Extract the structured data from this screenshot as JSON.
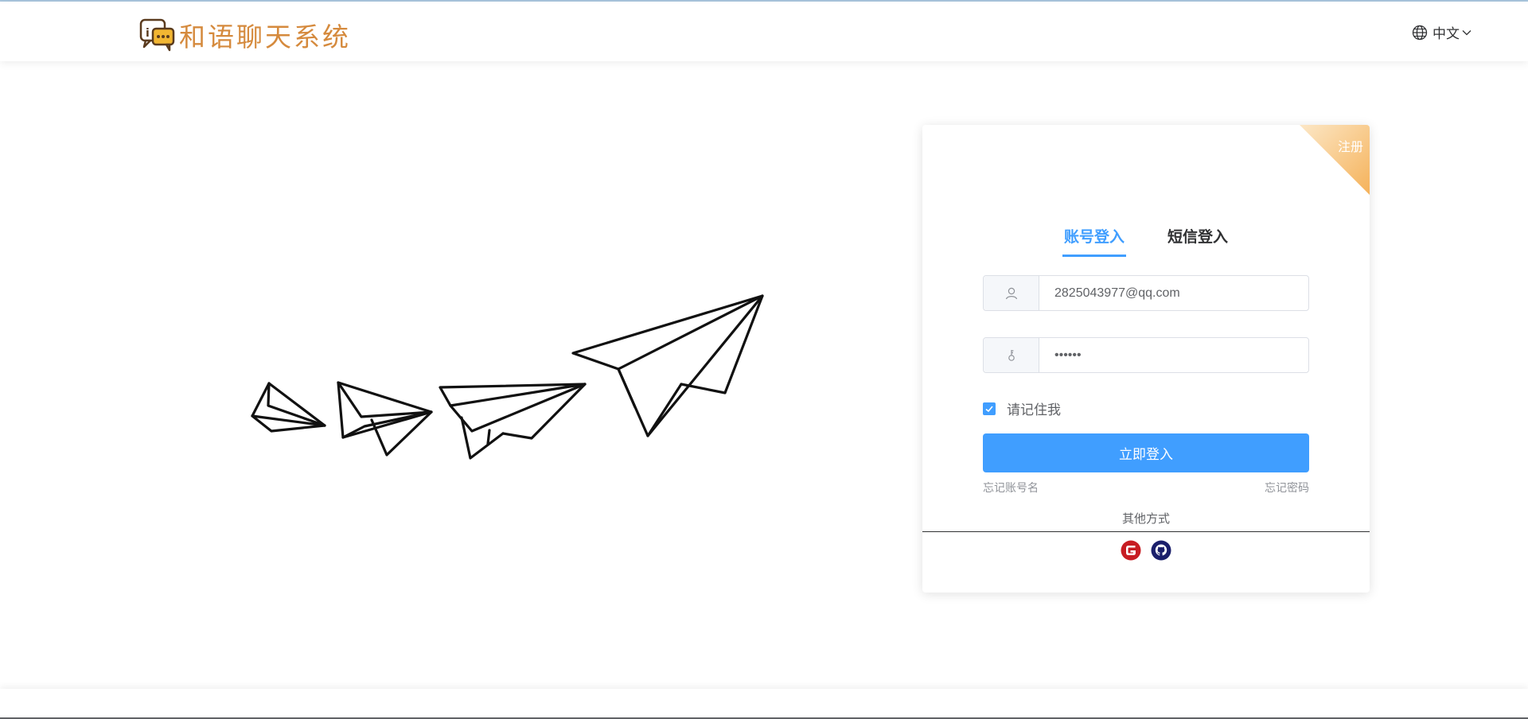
{
  "header": {
    "app_title": "和语聊天系统",
    "language": "中文"
  },
  "card": {
    "corner_label": "注册",
    "tabs": [
      {
        "label": "账号登入",
        "active": true
      },
      {
        "label": "短信登入",
        "active": false
      }
    ],
    "account": {
      "value": "2825043977@qq.com",
      "placeholder": ""
    },
    "password": {
      "value": "••••••",
      "placeholder": ""
    },
    "remember_label": "请记住我",
    "remember_checked": true,
    "login_button": "立即登入",
    "forgot_username": "忘记账号名",
    "forgot_password": "忘记密码",
    "other_methods": "其他方式",
    "social_icons": [
      "gitee-icon",
      "github-icon"
    ]
  },
  "colors": {
    "primary": "#409eff",
    "brand_text": "#d58a3d",
    "corner_ribbon": "#f5c27a",
    "gitee_red": "#c71d23",
    "github_navy": "#1b1f6b"
  }
}
